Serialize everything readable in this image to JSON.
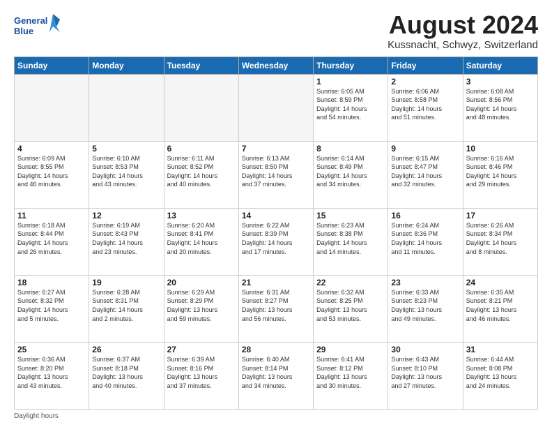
{
  "logo": {
    "line1": "General",
    "line2": "Blue"
  },
  "title": "August 2024",
  "subtitle": "Kussnacht, Schwyz, Switzerland",
  "days_of_week": [
    "Sunday",
    "Monday",
    "Tuesday",
    "Wednesday",
    "Thursday",
    "Friday",
    "Saturday"
  ],
  "footer": "Daylight hours",
  "weeks": [
    [
      {
        "day": "",
        "info": ""
      },
      {
        "day": "",
        "info": ""
      },
      {
        "day": "",
        "info": ""
      },
      {
        "day": "",
        "info": ""
      },
      {
        "day": "1",
        "info": "Sunrise: 6:05 AM\nSunset: 8:59 PM\nDaylight: 14 hours\nand 54 minutes."
      },
      {
        "day": "2",
        "info": "Sunrise: 6:06 AM\nSunset: 8:58 PM\nDaylight: 14 hours\nand 51 minutes."
      },
      {
        "day": "3",
        "info": "Sunrise: 6:08 AM\nSunset: 8:56 PM\nDaylight: 14 hours\nand 48 minutes."
      }
    ],
    [
      {
        "day": "4",
        "info": "Sunrise: 6:09 AM\nSunset: 8:55 PM\nDaylight: 14 hours\nand 46 minutes."
      },
      {
        "day": "5",
        "info": "Sunrise: 6:10 AM\nSunset: 8:53 PM\nDaylight: 14 hours\nand 43 minutes."
      },
      {
        "day": "6",
        "info": "Sunrise: 6:11 AM\nSunset: 8:52 PM\nDaylight: 14 hours\nand 40 minutes."
      },
      {
        "day": "7",
        "info": "Sunrise: 6:13 AM\nSunset: 8:50 PM\nDaylight: 14 hours\nand 37 minutes."
      },
      {
        "day": "8",
        "info": "Sunrise: 6:14 AM\nSunset: 8:49 PM\nDaylight: 14 hours\nand 34 minutes."
      },
      {
        "day": "9",
        "info": "Sunrise: 6:15 AM\nSunset: 8:47 PM\nDaylight: 14 hours\nand 32 minutes."
      },
      {
        "day": "10",
        "info": "Sunrise: 6:16 AM\nSunset: 8:46 PM\nDaylight: 14 hours\nand 29 minutes."
      }
    ],
    [
      {
        "day": "11",
        "info": "Sunrise: 6:18 AM\nSunset: 8:44 PM\nDaylight: 14 hours\nand 26 minutes."
      },
      {
        "day": "12",
        "info": "Sunrise: 6:19 AM\nSunset: 8:43 PM\nDaylight: 14 hours\nand 23 minutes."
      },
      {
        "day": "13",
        "info": "Sunrise: 6:20 AM\nSunset: 8:41 PM\nDaylight: 14 hours\nand 20 minutes."
      },
      {
        "day": "14",
        "info": "Sunrise: 6:22 AM\nSunset: 8:39 PM\nDaylight: 14 hours\nand 17 minutes."
      },
      {
        "day": "15",
        "info": "Sunrise: 6:23 AM\nSunset: 8:38 PM\nDaylight: 14 hours\nand 14 minutes."
      },
      {
        "day": "16",
        "info": "Sunrise: 6:24 AM\nSunset: 8:36 PM\nDaylight: 14 hours\nand 11 minutes."
      },
      {
        "day": "17",
        "info": "Sunrise: 6:26 AM\nSunset: 8:34 PM\nDaylight: 14 hours\nand 8 minutes."
      }
    ],
    [
      {
        "day": "18",
        "info": "Sunrise: 6:27 AM\nSunset: 8:32 PM\nDaylight: 14 hours\nand 5 minutes."
      },
      {
        "day": "19",
        "info": "Sunrise: 6:28 AM\nSunset: 8:31 PM\nDaylight: 14 hours\nand 2 minutes."
      },
      {
        "day": "20",
        "info": "Sunrise: 6:29 AM\nSunset: 8:29 PM\nDaylight: 13 hours\nand 59 minutes."
      },
      {
        "day": "21",
        "info": "Sunrise: 6:31 AM\nSunset: 8:27 PM\nDaylight: 13 hours\nand 56 minutes."
      },
      {
        "day": "22",
        "info": "Sunrise: 6:32 AM\nSunset: 8:25 PM\nDaylight: 13 hours\nand 53 minutes."
      },
      {
        "day": "23",
        "info": "Sunrise: 6:33 AM\nSunset: 8:23 PM\nDaylight: 13 hours\nand 49 minutes."
      },
      {
        "day": "24",
        "info": "Sunrise: 6:35 AM\nSunset: 8:21 PM\nDaylight: 13 hours\nand 46 minutes."
      }
    ],
    [
      {
        "day": "25",
        "info": "Sunrise: 6:36 AM\nSunset: 8:20 PM\nDaylight: 13 hours\nand 43 minutes."
      },
      {
        "day": "26",
        "info": "Sunrise: 6:37 AM\nSunset: 8:18 PM\nDaylight: 13 hours\nand 40 minutes."
      },
      {
        "day": "27",
        "info": "Sunrise: 6:39 AM\nSunset: 8:16 PM\nDaylight: 13 hours\nand 37 minutes."
      },
      {
        "day": "28",
        "info": "Sunrise: 6:40 AM\nSunset: 8:14 PM\nDaylight: 13 hours\nand 34 minutes."
      },
      {
        "day": "29",
        "info": "Sunrise: 6:41 AM\nSunset: 8:12 PM\nDaylight: 13 hours\nand 30 minutes."
      },
      {
        "day": "30",
        "info": "Sunrise: 6:43 AM\nSunset: 8:10 PM\nDaylight: 13 hours\nand 27 minutes."
      },
      {
        "day": "31",
        "info": "Sunrise: 6:44 AM\nSunset: 8:08 PM\nDaylight: 13 hours\nand 24 minutes."
      }
    ]
  ]
}
